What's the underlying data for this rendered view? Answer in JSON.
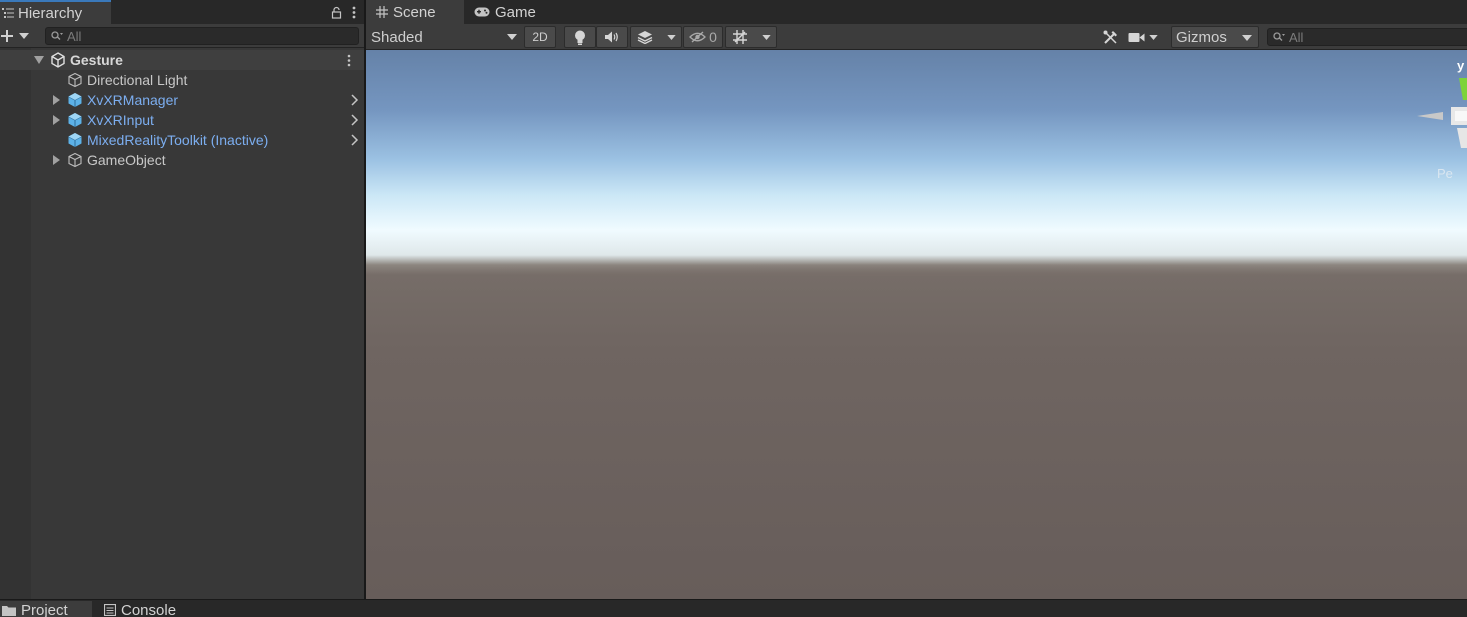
{
  "hierarchy": {
    "tab_label": "Hierarchy",
    "search_placeholder": "All",
    "scene_name": "Gesture",
    "items": [
      {
        "label": "Directional Light",
        "prefab": false,
        "expandable": false
      },
      {
        "label": "XvXRManager",
        "prefab": true,
        "expandable": true
      },
      {
        "label": "XvXRInput",
        "prefab": true,
        "expandable": true
      },
      {
        "label": "MixedRealityToolkit (Inactive)",
        "prefab": true,
        "expandable": false
      },
      {
        "label": "GameObject",
        "prefab": false,
        "expandable": true
      }
    ]
  },
  "scene": {
    "tabs": [
      "Scene",
      "Game"
    ],
    "draw_mode": "Shaded",
    "mode_2d": "2D",
    "hidden_count": "0",
    "gizmos_label": "Gizmos",
    "search_placeholder": "All",
    "gizmo_axis_label": "y",
    "gizmo_projection": "Pe"
  },
  "bottom": {
    "tabs": [
      "Project",
      "Console"
    ]
  },
  "colors": {
    "accent": "#3a79bb",
    "prefab_text": "#7caef0"
  }
}
